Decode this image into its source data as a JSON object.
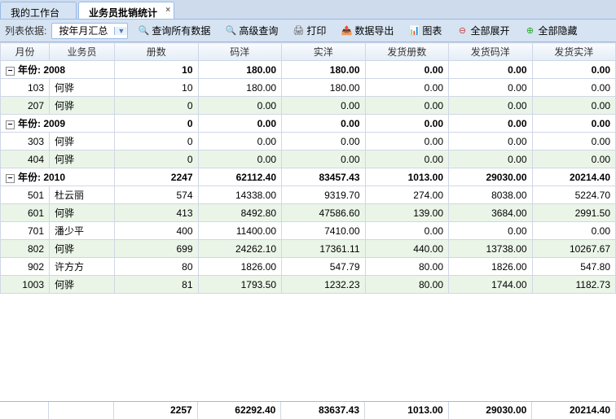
{
  "tabs": {
    "workbench": "我的工作台",
    "active": "业务员批销统计"
  },
  "toolbar": {
    "list_by_label": "列表依据:",
    "dropdown_value": "按年月汇总",
    "query_all": "查询所有数据",
    "adv_query": "高级查询",
    "print": "打印",
    "export": "数据导出",
    "chart": "图表",
    "expand_all": "全部展开",
    "collapse_all": "全部隐藏"
  },
  "headers": {
    "month": "月份",
    "salesperson": "业务员",
    "copies": "册数",
    "code_price": "码洋",
    "actual_price": "实洋",
    "ship_copies": "发货册数",
    "ship_code": "发货码洋",
    "ship_actual": "发货实洋"
  },
  "groups": [
    {
      "label": "年份: 2008",
      "totals": [
        "10",
        "180.00",
        "180.00",
        "0.00",
        "0.00",
        "0.00"
      ],
      "rows": [
        {
          "month": "103",
          "sales": "何骅",
          "vals": [
            "10",
            "180.00",
            "180.00",
            "0.00",
            "0.00",
            "0.00"
          ],
          "cls": "odd"
        },
        {
          "month": "207",
          "sales": "何骅",
          "vals": [
            "0",
            "0.00",
            "0.00",
            "0.00",
            "0.00",
            "0.00"
          ],
          "cls": "even"
        }
      ]
    },
    {
      "label": "年份: 2009",
      "totals": [
        "0",
        "0.00",
        "0.00",
        "0.00",
        "0.00",
        "0.00"
      ],
      "rows": [
        {
          "month": "303",
          "sales": "何骅",
          "vals": [
            "0",
            "0.00",
            "0.00",
            "0.00",
            "0.00",
            "0.00"
          ],
          "cls": "odd"
        },
        {
          "month": "404",
          "sales": "何骅",
          "vals": [
            "0",
            "0.00",
            "0.00",
            "0.00",
            "0.00",
            "0.00"
          ],
          "cls": "even"
        }
      ]
    },
    {
      "label": "年份: 2010",
      "totals": [
        "2247",
        "62112.40",
        "83457.43",
        "1013.00",
        "29030.00",
        "20214.40"
      ],
      "rows": [
        {
          "month": "501",
          "sales": "杜云丽",
          "vals": [
            "574",
            "14338.00",
            "9319.70",
            "274.00",
            "8038.00",
            "5224.70"
          ],
          "cls": "odd"
        },
        {
          "month": "601",
          "sales": "何骅",
          "vals": [
            "413",
            "8492.80",
            "47586.60",
            "139.00",
            "3684.00",
            "2991.50"
          ],
          "cls": "even"
        },
        {
          "month": "701",
          "sales": "潘少平",
          "vals": [
            "400",
            "11400.00",
            "7410.00",
            "0.00",
            "0.00",
            "0.00"
          ],
          "cls": "odd"
        },
        {
          "month": "802",
          "sales": "何骅",
          "vals": [
            "699",
            "24262.10",
            "17361.11",
            "440.00",
            "13738.00",
            "10267.67"
          ],
          "cls": "even"
        },
        {
          "month": "902",
          "sales": "许方方",
          "vals": [
            "80",
            "1826.00",
            "547.79",
            "80.00",
            "1826.00",
            "547.80"
          ],
          "cls": "odd"
        },
        {
          "month": "1003",
          "sales": "何骅",
          "vals": [
            "81",
            "1793.50",
            "1232.23",
            "80.00",
            "1744.00",
            "1182.73"
          ],
          "cls": "even"
        }
      ]
    }
  ],
  "footer": [
    "2257",
    "62292.40",
    "83637.43",
    "1013.00",
    "29030.00",
    "20214.40"
  ]
}
